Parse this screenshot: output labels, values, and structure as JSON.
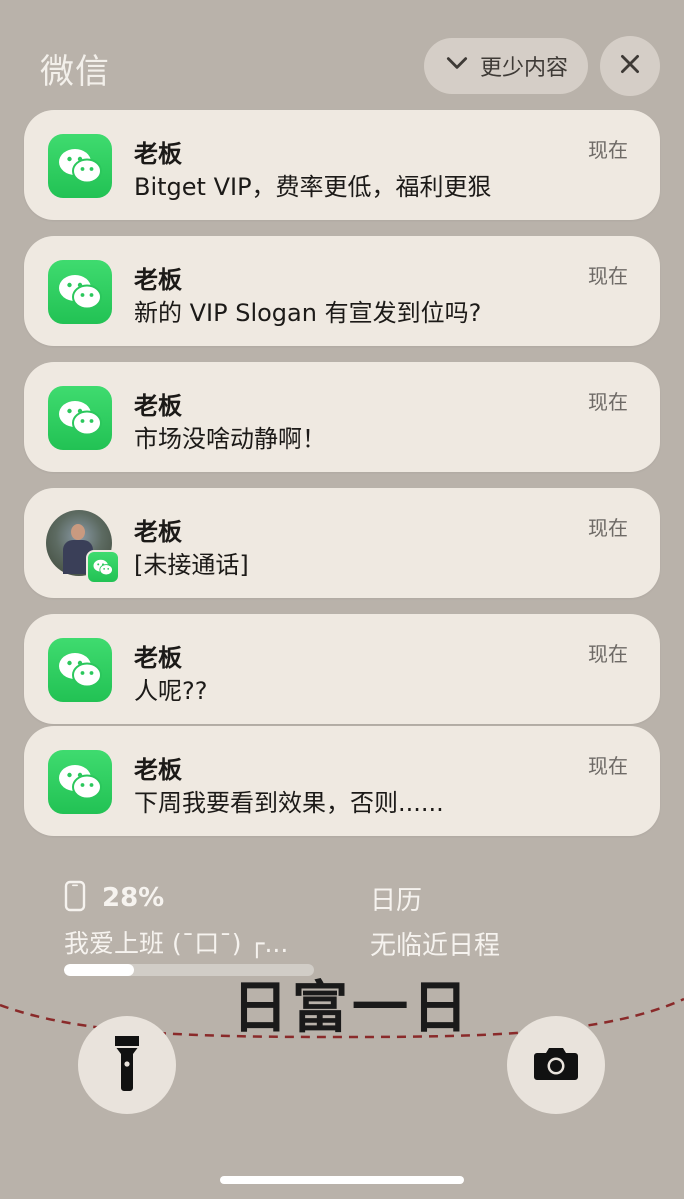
{
  "header": {
    "app_name": "微信",
    "show_less_label": "更少内容",
    "show_less_icon": "chevron-down-icon",
    "close_icon": "close-icon"
  },
  "notifications": [
    {
      "sender": "老板",
      "message": "Bitget VIP，费率更低，福利更狠",
      "time": "现在",
      "icon": "wechat-icon"
    },
    {
      "sender": "老板",
      "message": "新的 VIP Slogan 有宣发到位吗?",
      "time": "现在",
      "icon": "wechat-icon"
    },
    {
      "sender": "老板",
      "message": "市场没啥动静啊！",
      "time": "现在",
      "icon": "wechat-icon"
    },
    {
      "sender": "老板",
      "message": "[未接通话]",
      "time": "现在",
      "icon": "avatar-with-wechat-badge"
    },
    {
      "sender": "老板",
      "message": "人呢??",
      "time": "现在",
      "icon": "wechat-icon"
    },
    {
      "sender": "老板",
      "message": "下周我要看到效果，否则......",
      "time": "现在",
      "icon": "wechat-icon"
    }
  ],
  "battery_widget": {
    "percent": "28%",
    "caption": "我爱上班 (¯口¯) ┌...",
    "level": 0.28
  },
  "calendar_widget": {
    "title": "日历",
    "subtitle": "无临近日程"
  },
  "overlay_text": "日富一日",
  "controls": {
    "flashlight_icon": "flashlight-icon",
    "camera_icon": "camera-icon"
  },
  "colors": {
    "background": "#b9b2aa",
    "card": "#efe9e1",
    "wechat_green": "#22c254",
    "dashed_line": "#8a2a2a"
  }
}
